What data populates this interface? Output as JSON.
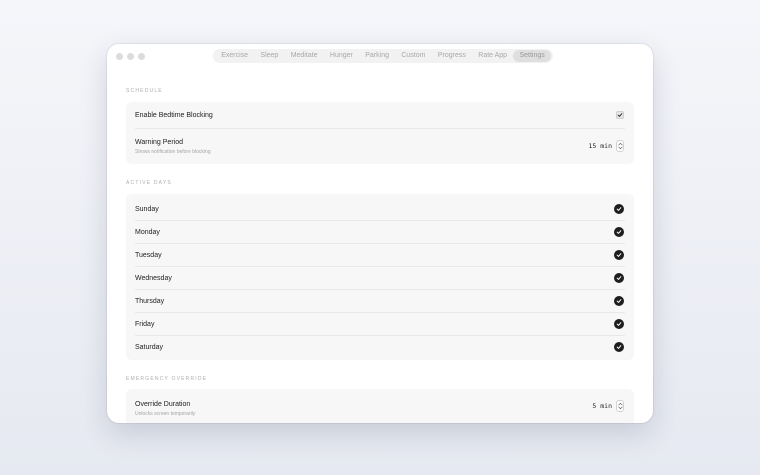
{
  "tabs": [
    {
      "label": "Exercise",
      "active": false
    },
    {
      "label": "Sleep",
      "active": false
    },
    {
      "label": "Meditate",
      "active": false
    },
    {
      "label": "Hunger",
      "active": false
    },
    {
      "label": "Parking",
      "active": false
    },
    {
      "label": "Custom",
      "active": false
    },
    {
      "label": "Progress",
      "active": false
    },
    {
      "label": "Rate App",
      "active": false
    },
    {
      "label": "Settings",
      "active": true
    }
  ],
  "schedule": {
    "title": "SCHEDULE",
    "enable_label": "Enable Bedtime Blocking",
    "enable_checked": true,
    "warning_label": "Warning Period",
    "warning_sub": "Shows notification before blocking",
    "warning_value": "15 min"
  },
  "active_days": {
    "title": "ACTIVE DAYS",
    "days": [
      {
        "label": "Sunday",
        "checked": true
      },
      {
        "label": "Monday",
        "checked": true
      },
      {
        "label": "Tuesday",
        "checked": true
      },
      {
        "label": "Wednesday",
        "checked": true
      },
      {
        "label": "Thursday",
        "checked": true
      },
      {
        "label": "Friday",
        "checked": true
      },
      {
        "label": "Saturday",
        "checked": true
      }
    ]
  },
  "emergency": {
    "title": "EMERGENCY OVERRIDE",
    "override_label": "Override Duration",
    "override_sub": "Unlocks screen temporarily",
    "override_value": "5 min"
  },
  "colors": {
    "check_fill": "#1e1e1e",
    "card_bg": "#f7f7f7",
    "background": "#eef0f6"
  }
}
